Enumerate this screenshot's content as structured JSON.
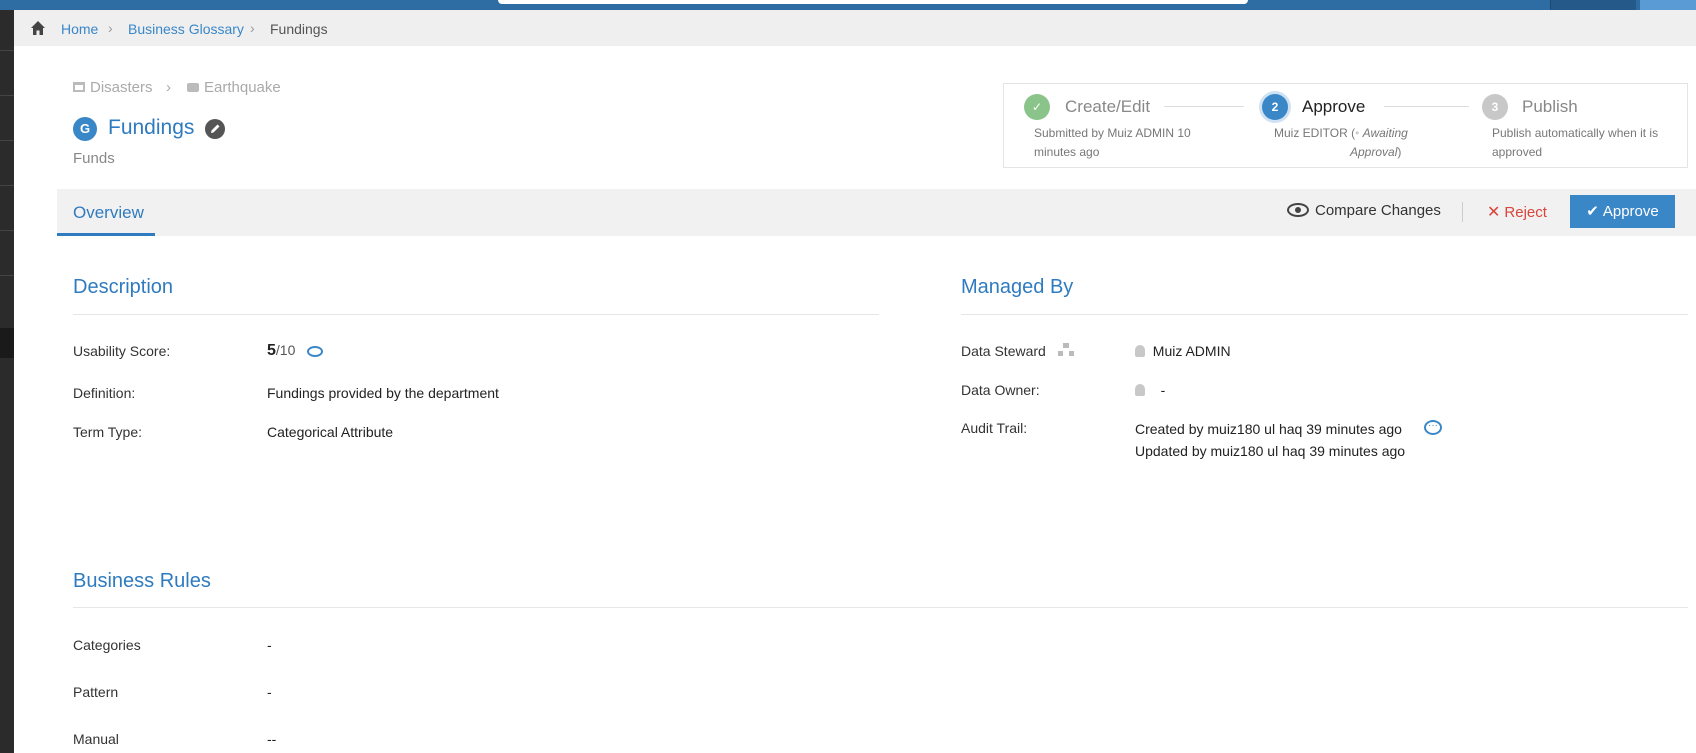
{
  "breadcrumb": {
    "items": [
      "Home",
      "Business Glossary"
    ],
    "current": "Fundings"
  },
  "path": {
    "parent": "Disasters",
    "child": "Earthquake"
  },
  "term": {
    "badge": "G",
    "title": "Fundings",
    "subtitle": "Funds"
  },
  "workflow": {
    "steps": [
      {
        "num": "✓",
        "label": "Create/Edit",
        "desc_line1": "Submitted by Muiz ADMIN 10",
        "desc_line2": "minutes ago",
        "state": "done"
      },
      {
        "num": "2",
        "label": "Approve",
        "desc_line1": "Muiz EDITOR (",
        "desc_status": "Awaiting",
        "desc_line2": "Approval",
        "desc_close": ")",
        "state": "active"
      },
      {
        "num": "3",
        "label": "Publish",
        "desc_line1": "Publish automatically when it is",
        "desc_line2": "approved",
        "state": "pending"
      }
    ]
  },
  "tabs": {
    "overview": "Overview"
  },
  "actions": {
    "compare": "Compare Changes",
    "reject": "Reject",
    "approve": "Approve"
  },
  "description": {
    "title": "Description",
    "usability_label": "Usability Score:",
    "usability_score": "5",
    "usability_total": "/10",
    "definition_label": "Definition:",
    "definition_value": "Fundings provided by the department",
    "term_type_label": "Term Type:",
    "term_type_value": "Categorical Attribute"
  },
  "managed_by": {
    "title": "Managed By",
    "steward_label": "Data Steward",
    "steward_value": "Muiz ADMIN",
    "owner_label": "Data Owner:",
    "owner_value": "-",
    "audit_label": "Audit Trail:",
    "audit_created": "Created by muiz180 ul haq 39 minutes ago",
    "audit_updated": "Updated by muiz180 ul haq 39 minutes ago"
  },
  "business_rules": {
    "title": "Business Rules",
    "rows": [
      {
        "label": "Categories",
        "value": "-"
      },
      {
        "label": "Pattern",
        "value": "-"
      },
      {
        "label": "Manual",
        "value": "--"
      }
    ]
  },
  "colors": {
    "brand": "#2e6da4",
    "link": "#3a87c8",
    "reject": "#d9453a",
    "done": "#8bc48a"
  }
}
